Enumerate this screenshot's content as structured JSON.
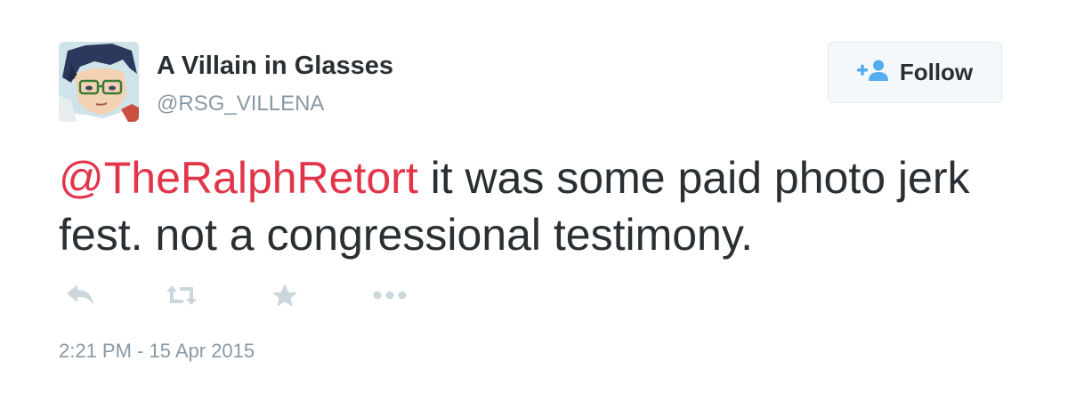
{
  "tweet": {
    "author": {
      "display_name": "A Villain in Glasses",
      "handle": "@RSG_VILLENA",
      "avatar_icon": "anime-character-with-glasses-avatar"
    },
    "follow_button": {
      "label": "Follow",
      "icon": "add-user-icon",
      "icon_color": "#55acee"
    },
    "text": {
      "mention": "@TheRalphRetort",
      "body": " it was some paid photo jerk fest. not a congressional testimony."
    },
    "mention_color": "#e2354a",
    "actions": [
      {
        "name": "reply",
        "icon": "reply-icon"
      },
      {
        "name": "retweet",
        "icon": "retweet-icon"
      },
      {
        "name": "favorite",
        "icon": "star-icon"
      },
      {
        "name": "more",
        "icon": "more-icon"
      }
    ],
    "action_icon_color": "#ccd6dd",
    "timestamp": "2:21 PM - 15 Apr 2015"
  }
}
